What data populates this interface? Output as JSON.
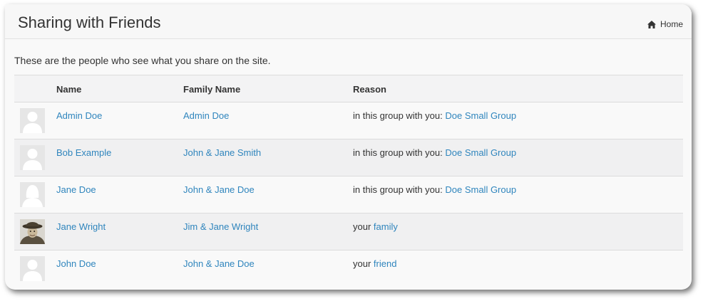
{
  "header": {
    "title": "Sharing with Friends",
    "breadcrumb_home": "Home"
  },
  "intro_text": "These are the people who see what you share on the site.",
  "table": {
    "columns": [
      "",
      "Name",
      "Family Name",
      "Reason"
    ],
    "rows": [
      {
        "name": "Admin Doe",
        "family": "Admin Doe",
        "reason_prefix": "in this group with you: ",
        "reason_link": "Doe Small Group",
        "avatar": "male-silhouette"
      },
      {
        "name": "Bob Example",
        "family": "John & Jane Smith",
        "reason_prefix": "in this group with you: ",
        "reason_link": "Doe Small Group",
        "avatar": "male-silhouette"
      },
      {
        "name": "Jane Doe",
        "family": "John & Jane Doe",
        "reason_prefix": "in this group with you: ",
        "reason_link": "Doe Small Group",
        "avatar": "female-silhouette"
      },
      {
        "name": "Jane Wright",
        "family": "Jim & Jane Wright",
        "reason_prefix": "your ",
        "reason_link": "family",
        "avatar": "photo"
      },
      {
        "name": "John Doe",
        "family": "John & Jane Doe",
        "reason_prefix": "your ",
        "reason_link": "friend",
        "avatar": "male-silhouette"
      }
    ]
  },
  "colors": {
    "link": "#2f85bd",
    "text": "#333333",
    "row_alt": "#f0f0f1",
    "panel": "#f9f9f9"
  }
}
